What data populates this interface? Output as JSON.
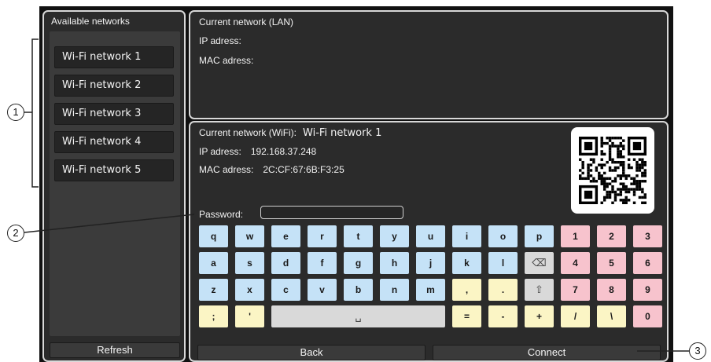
{
  "left_panel": {
    "title": "Available networks",
    "networks": [
      "Wi-Fi network 1",
      "Wi-Fi network 2",
      "Wi-Fi network 3",
      "Wi-Fi network 4",
      "Wi-Fi network 5"
    ],
    "refresh_label": "Refresh"
  },
  "lan": {
    "title": "Current network (LAN)",
    "ip_label": "IP adress:",
    "ip_value": "",
    "mac_label": "MAC adress:",
    "mac_value": ""
  },
  "wifi": {
    "title": "Current network (WiFi):",
    "network_name": "Wi-Fi network 1",
    "ip_label": "IP adress:",
    "ip_value": "192.168.37.248",
    "mac_label": "MAC adress:",
    "mac_value": "2C:CF:67:6B:F3:25",
    "password_label": "Password:",
    "password_value": ""
  },
  "keyboard": {
    "rows": [
      [
        {
          "label": "q",
          "color": "blue"
        },
        {
          "label": "w",
          "color": "blue"
        },
        {
          "label": "e",
          "color": "blue"
        },
        {
          "label": "r",
          "color": "blue"
        },
        {
          "label": "t",
          "color": "blue"
        },
        {
          "label": "y",
          "color": "blue"
        },
        {
          "label": "u",
          "color": "blue"
        },
        {
          "label": "i",
          "color": "blue"
        },
        {
          "label": "o",
          "color": "blue"
        },
        {
          "label": "p",
          "color": "blue"
        },
        {
          "label": "1",
          "color": "pink"
        },
        {
          "label": "2",
          "color": "pink"
        },
        {
          "label": "3",
          "color": "pink"
        }
      ],
      [
        {
          "label": "a",
          "color": "blue"
        },
        {
          "label": "s",
          "color": "blue"
        },
        {
          "label": "d",
          "color": "blue"
        },
        {
          "label": "f",
          "color": "blue"
        },
        {
          "label": "g",
          "color": "blue"
        },
        {
          "label": "h",
          "color": "blue"
        },
        {
          "label": "j",
          "color": "blue"
        },
        {
          "label": "k",
          "color": "blue"
        },
        {
          "label": "l",
          "color": "blue"
        },
        {
          "label": "⌫",
          "color": "gray"
        },
        {
          "label": "4",
          "color": "pink"
        },
        {
          "label": "5",
          "color": "pink"
        },
        {
          "label": "6",
          "color": "pink"
        }
      ],
      [
        {
          "label": "z",
          "color": "blue"
        },
        {
          "label": "x",
          "color": "blue"
        },
        {
          "label": "c",
          "color": "blue"
        },
        {
          "label": "v",
          "color": "blue"
        },
        {
          "label": "b",
          "color": "blue"
        },
        {
          "label": "n",
          "color": "blue"
        },
        {
          "label": "m",
          "color": "blue"
        },
        {
          "label": ",",
          "color": "yellow"
        },
        {
          "label": ".",
          "color": "yellow"
        },
        {
          "label": "⇧",
          "color": "gray"
        },
        {
          "label": "7",
          "color": "pink"
        },
        {
          "label": "8",
          "color": "pink"
        },
        {
          "label": "9",
          "color": "pink"
        }
      ],
      [
        {
          "label": ";",
          "color": "yellow"
        },
        {
          "label": "'",
          "color": "yellow"
        },
        {
          "label": "␣",
          "color": "gray",
          "span": 5
        },
        {
          "label": "=",
          "color": "yellow"
        },
        {
          "label": "-",
          "color": "yellow"
        },
        {
          "label": "+",
          "color": "yellow"
        },
        {
          "label": "/",
          "color": "yellow"
        },
        {
          "label": "\\",
          "color": "yellow"
        },
        {
          "label": "0",
          "color": "pink"
        }
      ]
    ]
  },
  "buttons": {
    "back_label": "Back",
    "connect_label": "Connect"
  },
  "callouts": [
    "1",
    "2",
    "3"
  ],
  "colors": {
    "panel_bg": "#2b2b2b",
    "key_blue": "#c5e2f7",
    "key_pink": "#f7c3cd",
    "key_yellow": "#fbf5c5",
    "key_gray": "#d9d9d9"
  }
}
